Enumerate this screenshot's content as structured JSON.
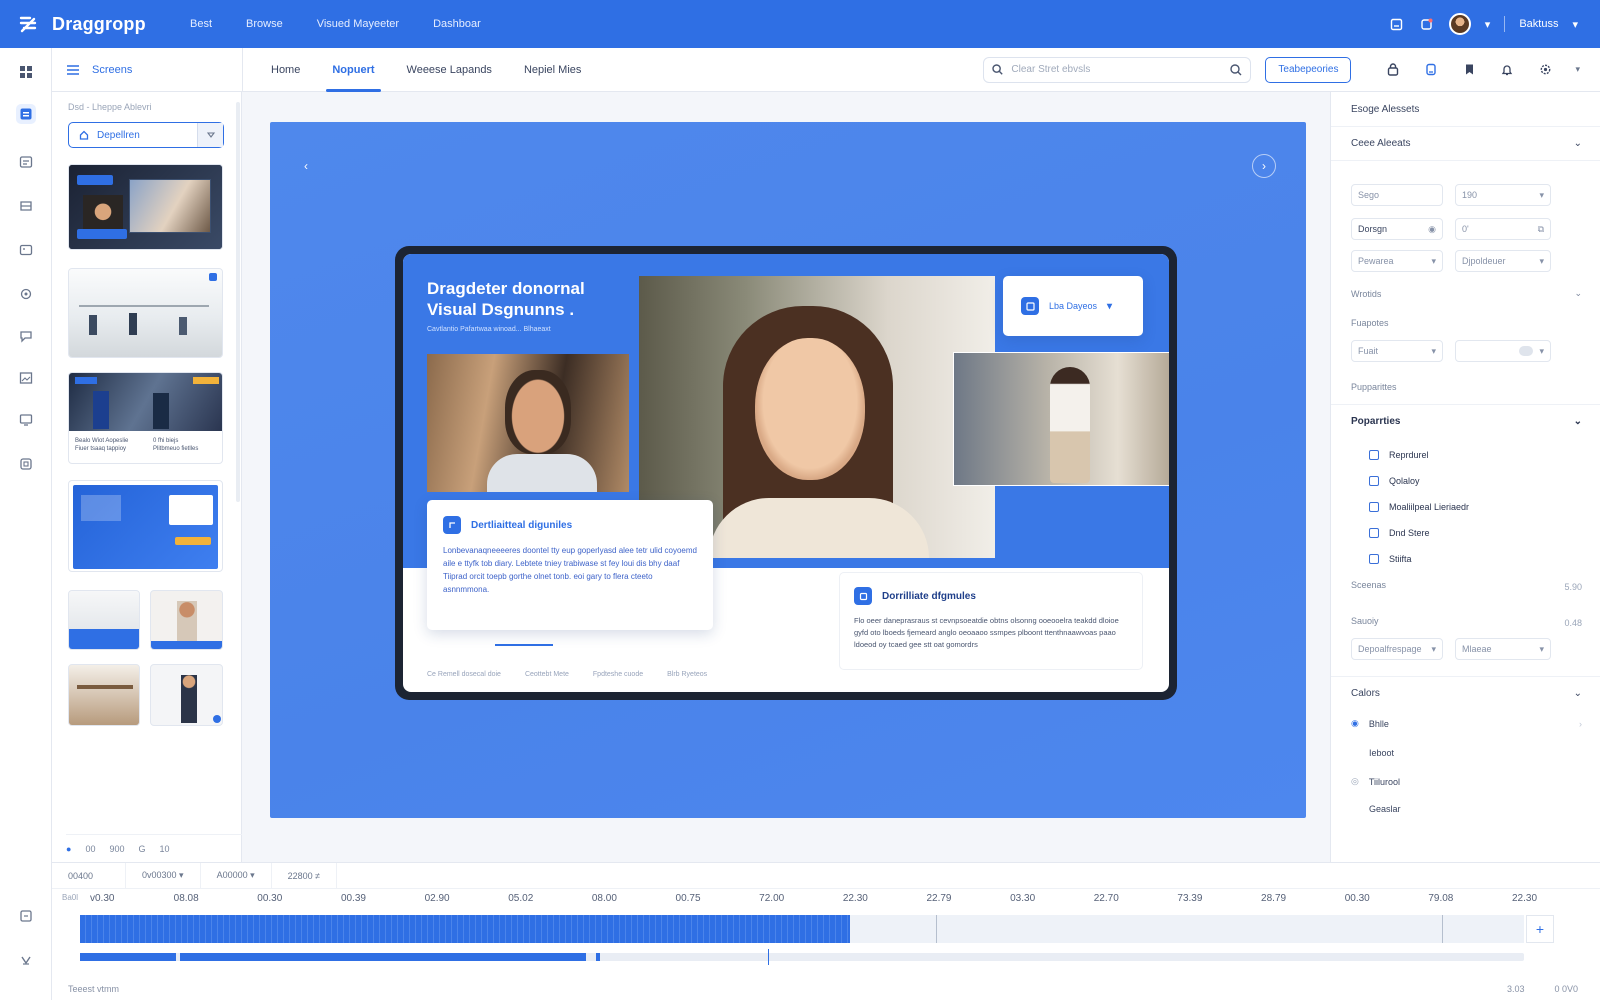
{
  "app": {
    "name": "Draggropp"
  },
  "topnav": [
    "Best",
    "Browse",
    "Visued Mayeeter",
    "Dashboar"
  ],
  "topright": {
    "user_label": "Baktuss"
  },
  "subbar": {
    "screens_label": "Screens",
    "tabs": [
      "Home",
      "Nopuert",
      "Weeese Lapands",
      "Nepiel Mies"
    ],
    "search_placeholder": "Clear Stret ebvsls",
    "action_button": "Teabepeories"
  },
  "leftpanel": {
    "header": "Dsd - Lheppe Ablevri",
    "input_value": "Depellren",
    "footer_items": [
      "00",
      "900",
      "G",
      "10"
    ],
    "thumb3_caption": [
      "Bealo Wiot  Aopeslie",
      "Fiuer tsaaq tappioy"
    ],
    "thumb3_caption2": [
      "0 fhi biejs",
      "Plitbmeuo fietlles"
    ]
  },
  "stage": {
    "title": "Dragdeter donornal Visual Dsgnunns .",
    "subtitle": "Cavtlantio Pafartwaa winoad... Blhaeaxt",
    "card1_title": "Dertliaitteal diguniles",
    "card1_text": "Lonbevanaqneeeeres doontel tty eup goperlyasd alee tetr ulid coyoemd aile e ttyfk tob diary. Lebtete tniey trabiwase st fey loui dis bhy daaf Tiiprad orcit toepb gorthe olnet tonb. eoi gary to flera cteeto asnnmmona.",
    "card2_title": "Dorrilliate dfgmules",
    "card2_text": "Flo oeer daneprasraus st cevnpsoeatdie obtns olsonng ooeooelra teakdd dloioe gyfd oto lboeds fjemeard anglo oeoaaoo ssmpes plboont ttenthnaawvoas paao ldoeod oy tcaed gee stt oat gomordrs",
    "drop_label": "Lba Dayeos",
    "links": [
      "Ce Remell dosecal doie",
      "Ceottebt Mete",
      "Fpdteshe cuode",
      "Blrb Ryeteos"
    ]
  },
  "rightpanel": {
    "header": "Esoge Alessets",
    "section1": "Ceee Aleeats",
    "field_size_label": "Sego",
    "field_size_value": "190",
    "field_design_label": "Dorsgn",
    "field_design_value": "0'",
    "sel_a": "Pewarea",
    "sel_b": "Djpoldeuer",
    "section_visuals": "Wrotids",
    "section_fonts": "Fuapotes",
    "sel_c": "Fuait",
    "section_prop_small": "Pupparittes",
    "section_properties": "Poparrties",
    "props": [
      "Reprdurel",
      "Qolaloy",
      "Moaliilpeal Lieriaedr",
      "Dnd Stere",
      "Stiifta"
    ],
    "row_scale": "Sceenas",
    "row_scale_value": "5.90",
    "row_opacity": "Sauoiy",
    "row_opacity_value": "0.48",
    "sel_d": "Depoalfrespage",
    "sel_e": "Mlaeae",
    "section_colors": "Calors",
    "colors": [
      "Bhlle",
      "Ieboot",
      "Tiilurool",
      "Geaslar"
    ]
  },
  "timeline": {
    "controls": [
      "00400",
      "0v00300 ▾",
      "A00000 ▾",
      "22800 ≠"
    ],
    "ruler": [
      "Ba0l",
      "v0.30",
      "08.08",
      "00.30",
      "00.39",
      "02.90",
      "05.02",
      "08.00",
      "00.75",
      "72.00",
      "22.30",
      "22.79",
      "03.30",
      "22.70",
      "73.39",
      "28.79",
      "00.30",
      "79.08",
      "22.30"
    ],
    "footer_left": "Teeest vtmm",
    "footer_right": [
      "3.03",
      "0 0V0"
    ]
  },
  "colors": {
    "accent": "#2f6fe4",
    "stage": "#4a83ea"
  }
}
